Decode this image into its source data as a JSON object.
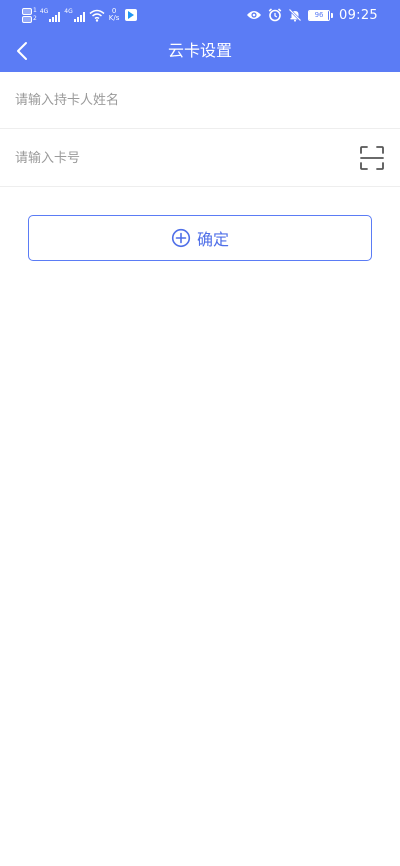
{
  "status_bar": {
    "network_1": "4G",
    "network_2": "4G",
    "speed_value": "0",
    "speed_unit": "K/s",
    "battery_level": "96",
    "time": "09:25",
    "icons": [
      "sim-icon",
      "signal-icon",
      "wifi-icon",
      "notification-icon",
      "eye-icon",
      "alarm-icon",
      "mute-icon",
      "battery-icon"
    ]
  },
  "nav": {
    "title": "云卡设置",
    "back_icon": "chevron-left-icon"
  },
  "form": {
    "name_placeholder": "请输入持卡人姓名",
    "name_value": "",
    "card_placeholder": "请输入卡号",
    "card_value": "",
    "scan_icon": "scan-icon"
  },
  "confirm": {
    "label": "确定",
    "icon": "plus-circle-icon"
  },
  "colors": {
    "primary": "#5b7cf5",
    "button_text": "#4f6fe8",
    "placeholder": "#9a9a9a",
    "divider": "#eeeeee"
  }
}
